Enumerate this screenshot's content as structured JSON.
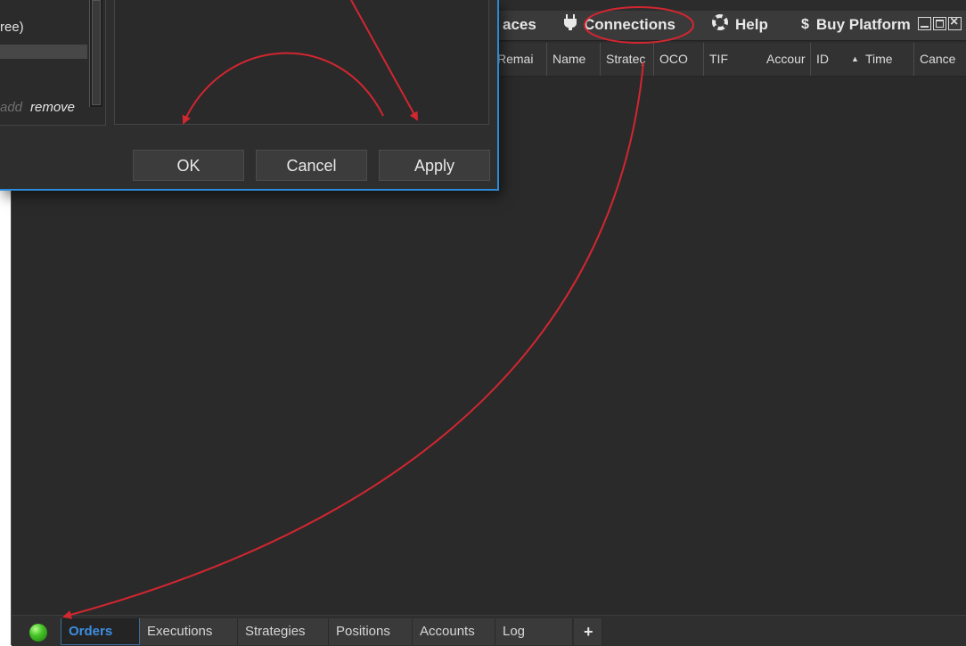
{
  "menubar": {
    "items": [
      {
        "label": "aces",
        "icon": ""
      },
      {
        "label": "Connections",
        "icon": "plug-icon"
      },
      {
        "label": "Help",
        "icon": "lifebuoy-icon"
      },
      {
        "label": "Buy Platform",
        "icon": "dollar-icon"
      }
    ]
  },
  "grid": {
    "columns": [
      "Remai",
      "Name",
      "Strateç",
      "OCO",
      "TIF",
      "Accour",
      "ID",
      "Time",
      "Cance"
    ]
  },
  "tabs": {
    "items": [
      "Orders",
      "Executions",
      "Strategies",
      "Positions",
      "Accounts",
      "Log"
    ],
    "active": "Orders",
    "add_label": "+"
  },
  "status": {
    "connection_color": "#45c327"
  },
  "dialog": {
    "list_text": "ree)",
    "add_link": "add",
    "remove_link": "remove",
    "ok_label": "OK",
    "cancel_label": "Cancel",
    "apply_label": "Apply"
  },
  "colors": {
    "accent": "#2c8ad8",
    "annotation": "#d22630"
  }
}
